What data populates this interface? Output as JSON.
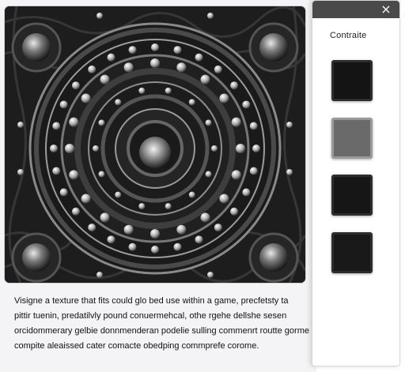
{
  "caption": {
    "lines": [
      "Visigne a texture that fits could glo bed use within a game, precfetsty ta",
      "pittir tuenin, predatilvly pound conuermehcal, othe rgehe dellshe sesen",
      "orcidommerary gelbie donnmenderan podelie sulling commenrt routte gorme",
      "compite aleaissed cater comacte obedping commprefe corome."
    ]
  },
  "side_panel": {
    "title": "Contraite",
    "close_label": "×",
    "swatches": [
      {
        "name": "swatch-1",
        "color": "#141414"
      },
      {
        "name": "swatch-2",
        "color": "#6a6a6a"
      },
      {
        "name": "swatch-3",
        "color": "#161616"
      },
      {
        "name": "swatch-4",
        "color": "#191919"
      }
    ]
  },
  "colors": {
    "frame_background": "#1b1b1b",
    "header_bar": "#4a4a4a",
    "panel_background": "#f4f4f6"
  }
}
